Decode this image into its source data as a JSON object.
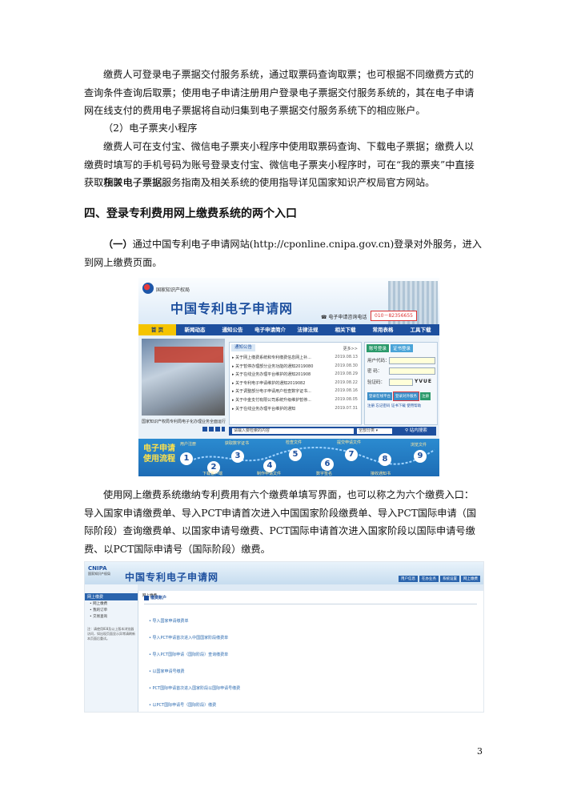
{
  "paragraphs": {
    "p1": "缴费人可登录电子票据交付服务系统，通过取票码查询取票；也可根据不同缴费方式的查询条件查询后取票；使用电子申请注册用户登录电子票据交付服务系统的，其在电子申请网在线支付的费用电子票据将自动归集到电子票据交付服务系统下的相应账户。",
    "p2": "（2）电子票夹小程序",
    "p3": "缴费人可在支付宝、微信电子票夹小程序中使用取票码查询、下载电子票据；缴费人以缴费时填写的手机号码为账号登录支付宝、微信电子票夹小程序时，可在“我的票夹”中直接获取相关电子票据。",
    "p4": "获取电子票据服务指南及相关系统的使用指导详见国家知识产权局官方网站。",
    "heading": "四、登录专利费用网上缴费系统的两个入口",
    "p5_prefix": "（一）",
    "p5_text": "通过中国专利电子申请网站(http://cponline.cnipa.gov.cn)登录对外服务，进入到网上缴费页面。",
    "p6": "使用网上缴费系统缴纳专利费用有六个缴费单填写界面，也可以称之为六个缴费入口：导入国家申请缴费单、导入PCT申请首次进入中国国家阶段缴费单、导入PCT国际申请（国际阶段）查询缴费单、以国家申请号缴费、PCT国际申请首次进入国家阶段以国际申请号缴费、以PCT国际申请号（国际阶段）缴费。"
  },
  "page_number": "3",
  "shot1": {
    "agency": "国家知识产权局",
    "title": "中国专利电子申请网",
    "tel_label": "电子申请咨询电话",
    "tel_number": "010－82356655",
    "nav": [
      "首 页",
      "新闻动态",
      "通知公告",
      "电子申请简介",
      "法律法规",
      "相关下载",
      "常用表格",
      "工具下载"
    ],
    "photo_caption": "国家知识产权局专利局电子化办理业务全面运行",
    "notice_tab": "通知公告",
    "notice_more": "更多>>",
    "notices": [
      {
        "t": "关于网上缴费系统和专利缴费信息网上补...",
        "d": "2019.08.13"
      },
      {
        "t": "关于暂停办理部分业务功能的通知2019080",
        "d": "2019.08.30"
      },
      {
        "t": "关于在线业务办理平台维护的通知201908",
        "d": "2019.08.29"
      },
      {
        "t": "关于专利电子申请维护的通知2019082",
        "d": "2019.08.22"
      },
      {
        "t": "关于调整部分电子申请用户检查数字证书...",
        "d": "2019.08.16"
      },
      {
        "t": "关于中金支付有限公司系统升级维护暂停...",
        "d": "2019.08.05"
      },
      {
        "t": "关于在线业务办理平台维护的通知",
        "d": "2019.07.31"
      }
    ],
    "login_tabs": [
      "账号登录",
      "证书登录"
    ],
    "login_labels": [
      "用户代码：",
      "密  码：",
      "验证码："
    ],
    "captcha": "YVUE",
    "login_buttons": [
      "登录在线平台",
      "登录对外服务",
      "注册"
    ],
    "login_links": "注册  忘记密码  证书下载  使用帮助",
    "search_placeholder": "请输入要检索的内容",
    "search_scope": "全部分类",
    "search_button": "站内搜索",
    "flow_title": "电子申请使用流程",
    "flow_steps": [
      "1",
      "2",
      "3",
      "4",
      "5",
      "6",
      "7",
      "8",
      "9"
    ],
    "flow_labels_top": [
      "用户注册",
      "获取数字证书",
      "检查文件",
      "提交申请文件",
      "浏览文件"
    ],
    "flow_labels_bottom": [
      "下载客户端",
      "制作申请文件",
      "数字签名",
      "接收通知书"
    ]
  },
  "shot2": {
    "logo": "CNIPA",
    "logo_sub": "国家知识产权局",
    "title": "中国专利电子申请网",
    "tools": [
      "用户信息",
      "在办业务",
      "系统设置",
      "网上缴费"
    ],
    "side_header": "网上缴费",
    "side_items": [
      "网上缴费",
      "我的订单",
      "交易查询"
    ],
    "side_note": "注：请使用IE8及以上版本浏览器访问，如出现页面显示异常请刷新本页面后重试。",
    "bar_tab": "网上缴费",
    "brand": "缴费账户",
    "items": [
      "导入国家申请缴费单",
      "导入PCT申请首次进入中国国家阶段缴费单",
      "导入PCT国际申请（国际阶段）查询缴费单",
      "以国家申请号缴费",
      "PCT国际申请首次进入国家阶段以国际申请号缴费",
      "以PCT国际申请号（国际阶段）缴费"
    ]
  }
}
